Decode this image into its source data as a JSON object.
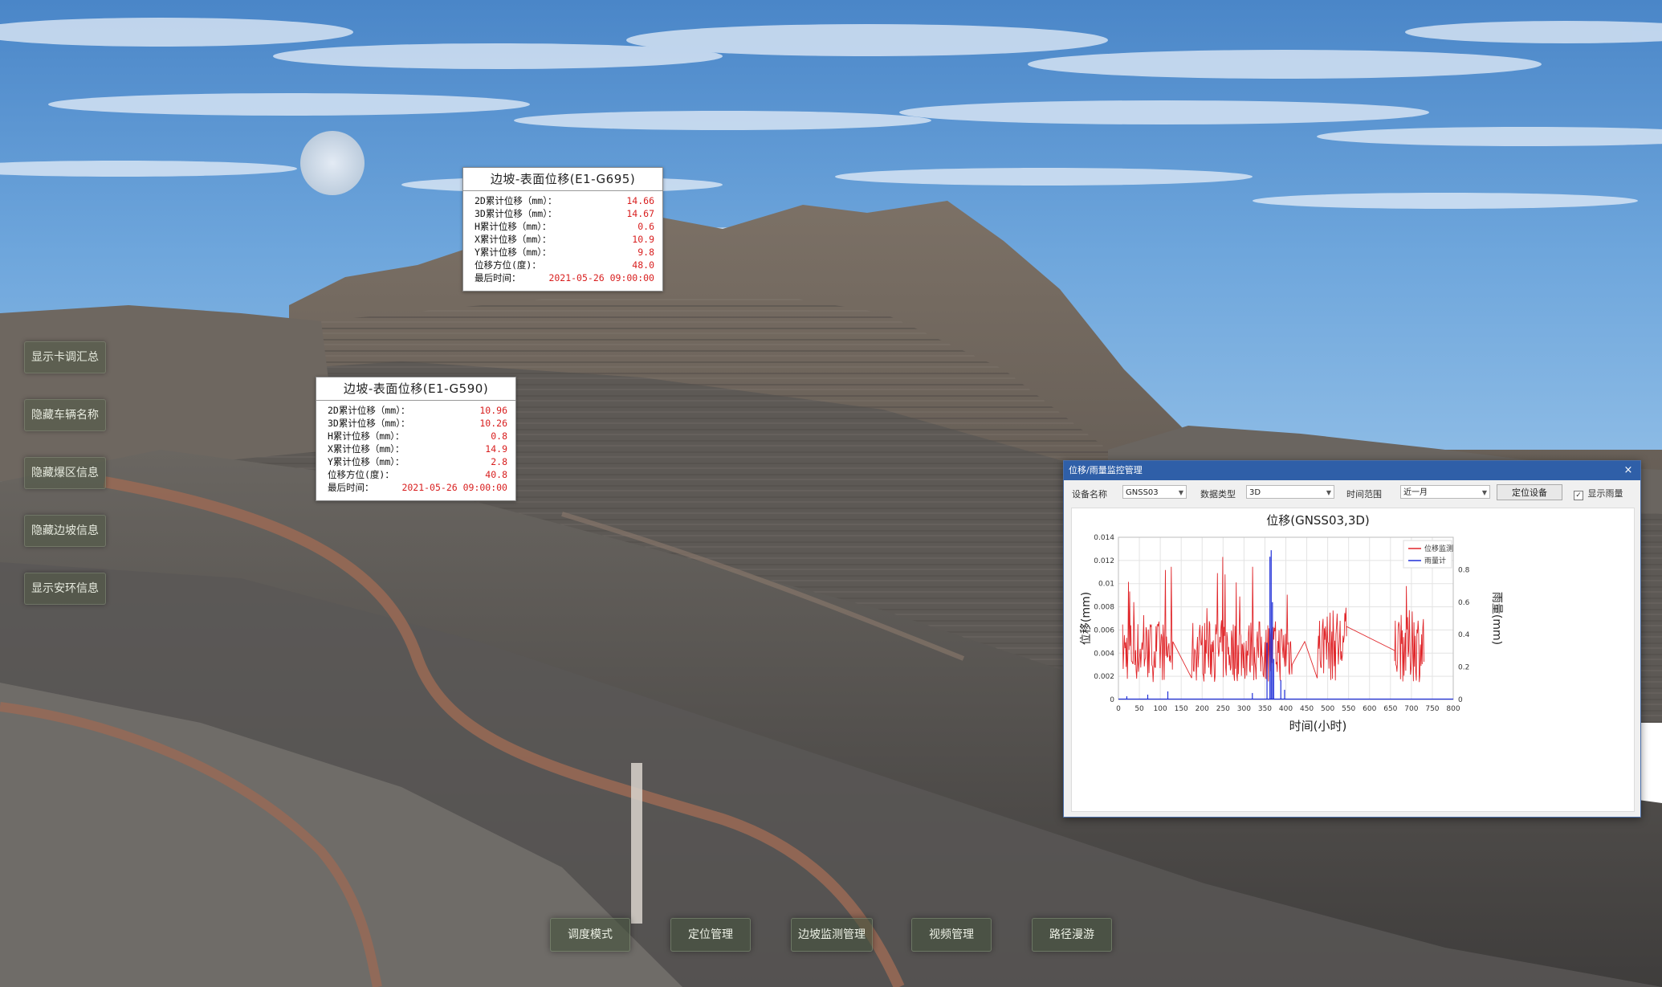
{
  "side_buttons": [
    {
      "label": "显示卡调汇总"
    },
    {
      "label": "隐藏车辆名称"
    },
    {
      "label": "隐藏爆区信息"
    },
    {
      "label": "隐藏边坡信息"
    },
    {
      "label": "显示安环信息"
    }
  ],
  "bottom_buttons": [
    {
      "label": "调度模式"
    },
    {
      "label": "定位管理"
    },
    {
      "label": "边坡监测管理"
    },
    {
      "label": "视频管理"
    },
    {
      "label": "路径漫游"
    }
  ],
  "popups": [
    {
      "title": "边坡-表面位移(E1-G695)",
      "rows": [
        {
          "label": "2D累计位移（mm）：",
          "value": "14.66"
        },
        {
          "label": "3D累计位移（mm）：",
          "value": "14.67"
        },
        {
          "label": "H累计位移（mm）：",
          "value": "0.6"
        },
        {
          "label": "X累计位移（mm）：",
          "value": "10.9"
        },
        {
          "label": "Y累计位移（mm）：",
          "value": "9.8"
        },
        {
          "label": "位移方位(度)：",
          "value": "48.0"
        },
        {
          "label": "最后时间：",
          "value": "2021-05-26 09:00:00"
        }
      ]
    },
    {
      "title": "边坡-表面位移(E1-G590)",
      "rows": [
        {
          "label": "2D累计位移（mm）：",
          "value": "10.96"
        },
        {
          "label": "3D累计位移（mm）：",
          "value": "10.26"
        },
        {
          "label": "H累计位移（mm）：",
          "value": "0.8"
        },
        {
          "label": "X累计位移（mm）：",
          "value": "14.9"
        },
        {
          "label": "Y累计位移（mm）：",
          "value": "2.8"
        },
        {
          "label": "位移方位(度)：",
          "value": "40.8"
        },
        {
          "label": "最后时间：",
          "value": "2021-05-26 09:00:00"
        }
      ]
    }
  ],
  "dialog": {
    "title": "位移/雨量监控管理",
    "close": "×",
    "device_label": "设备名称",
    "device_value": "GNSS03",
    "type_label": "数据类型",
    "type_value": "3D",
    "range_label": "时间范围",
    "range_value": "近一月",
    "locate_button": "定位设备",
    "show_rain_label": "显示雨量",
    "show_rain_checked": "✓"
  },
  "chart_data": {
    "type": "line",
    "title": "位移(GNSS03,3D)",
    "xlabel": "时间(小时)",
    "ylabel": "位移(mm)",
    "y2label": "雨量(mm)",
    "xlim": [
      0,
      800
    ],
    "ylim": [
      0,
      0.014
    ],
    "y2lim": [
      0,
      1.0
    ],
    "x_ticks": [
      "0",
      "50",
      "100",
      "150",
      "200",
      "250",
      "300",
      "350",
      "400",
      "450",
      "500",
      "550",
      "600",
      "650",
      "700",
      "750",
      "800"
    ],
    "y_ticks": [
      "0",
      "0.002",
      "0.004",
      "0.006",
      "0.008",
      "0.01",
      "0.012",
      "0.014"
    ],
    "y2_ticks": [
      "0",
      "0.2",
      "0.4",
      "0.6",
      "0.8"
    ],
    "grid": true,
    "legend_position": "top-right",
    "series": [
      {
        "name": "位移监测",
        "color": "#e0262a",
        "axis": "left",
        "segments": [
          {
            "x_start": 10,
            "x_end": 130,
            "y_min": 0.0015,
            "y_max": 0.0115,
            "y_mean": 0.0045
          },
          {
            "x_start": 130,
            "x_end": 175,
            "y_min": 0.0015,
            "y_max": 0.005,
            "trend": "linear-down"
          },
          {
            "x_start": 175,
            "x_end": 415,
            "y_min": 0.0015,
            "y_max": 0.0125,
            "y_mean": 0.0045
          },
          {
            "x_start": 415,
            "x_end": 445,
            "y_min": 0.003,
            "y_max": 0.005,
            "trend": "linear-up"
          },
          {
            "x_start": 475,
            "x_end": 545,
            "y_min": 0.0015,
            "y_max": 0.0095,
            "y_mean": 0.005
          },
          {
            "x_start": 545,
            "x_end": 660,
            "y_min": 0.004,
            "y_max": 0.0063,
            "trend": "linear-down"
          },
          {
            "x_start": 660,
            "x_end": 730,
            "y_min": 0.0015,
            "y_max": 0.0098,
            "y_mean": 0.005
          }
        ]
      },
      {
        "name": "雨量计",
        "color": "#1f2fd8",
        "axis": "right",
        "spikes": [
          {
            "x": 20,
            "value": 0.02
          },
          {
            "x": 70,
            "value": 0.03
          },
          {
            "x": 118,
            "value": 0.05
          },
          {
            "x": 320,
            "value": 0.04
          },
          {
            "x": 355,
            "value": 0.35
          },
          {
            "x": 362,
            "value": 0.88
          },
          {
            "x": 365,
            "value": 0.92
          },
          {
            "x": 368,
            "value": 0.6
          },
          {
            "x": 371,
            "value": 0.25
          },
          {
            "x": 388,
            "value": 0.12
          },
          {
            "x": 397,
            "value": 0.06
          }
        ]
      }
    ]
  }
}
